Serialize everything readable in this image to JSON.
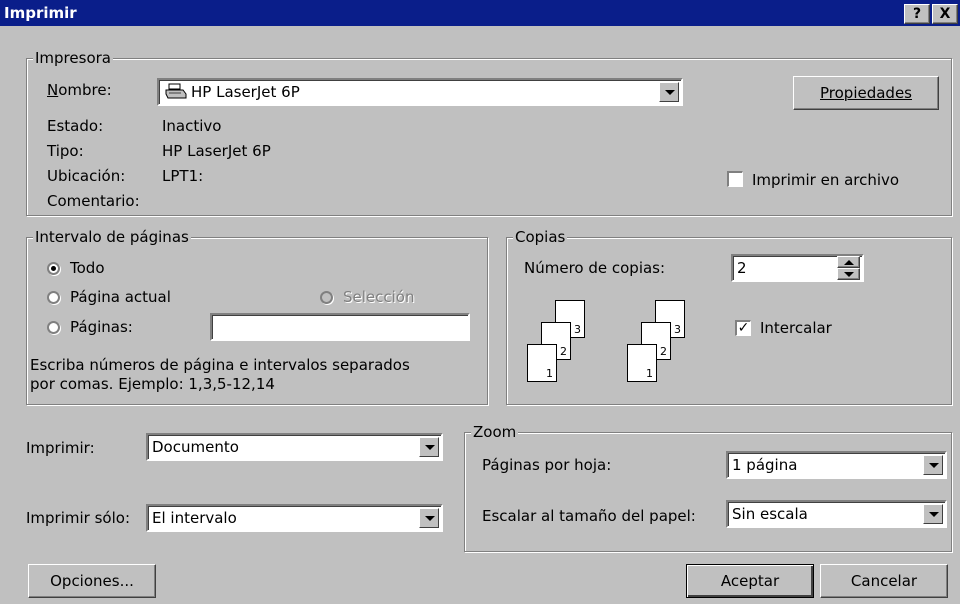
{
  "dialog": {
    "title": "Imprimir",
    "help_label": "?",
    "close_label": "X"
  },
  "printer": {
    "legend": "Impresora",
    "name_label": "Nombre:",
    "name_value": "HP LaserJet 6P",
    "properties_label": "Propiedades",
    "status_label": "Estado:",
    "status_value": "Inactivo",
    "type_label": "Tipo:",
    "type_value": "HP LaserJet 6P",
    "location_label": "Ubicación:",
    "location_value": "LPT1:",
    "comment_label": "Comentario:",
    "print_to_file_label": "Imprimir en archivo",
    "print_to_file_checked": false
  },
  "range": {
    "legend": "Intervalo de páginas",
    "all_label": "Todo",
    "current_label": "Página actual",
    "selection_label": "Selección",
    "pages_label": "Páginas:",
    "pages_value": "",
    "hint_line1": "Escriba números de página e intervalos separados",
    "hint_line2": "por comas. Ejemplo: 1,3,5-12,14",
    "selected": "all"
  },
  "copies": {
    "legend": "Copias",
    "count_label": "Número de copias:",
    "count_value": "2",
    "collate_label": "Intercalar",
    "collate_checked": true,
    "page_numbers": [
      "1",
      "2",
      "3"
    ]
  },
  "print_what": {
    "label": "Imprimir:",
    "value": "Documento"
  },
  "print_only": {
    "label": "Imprimir sólo:",
    "value": "El intervalo"
  },
  "zoom": {
    "legend": "Zoom",
    "pages_per_sheet_label": "Páginas por hoja:",
    "pages_per_sheet_value": "1 página",
    "scale_label": "Escalar al tamaño del papel:",
    "scale_value": "Sin escala"
  },
  "buttons": {
    "options": "Opciones...",
    "ok": "Aceptar",
    "cancel": "Cancelar"
  }
}
